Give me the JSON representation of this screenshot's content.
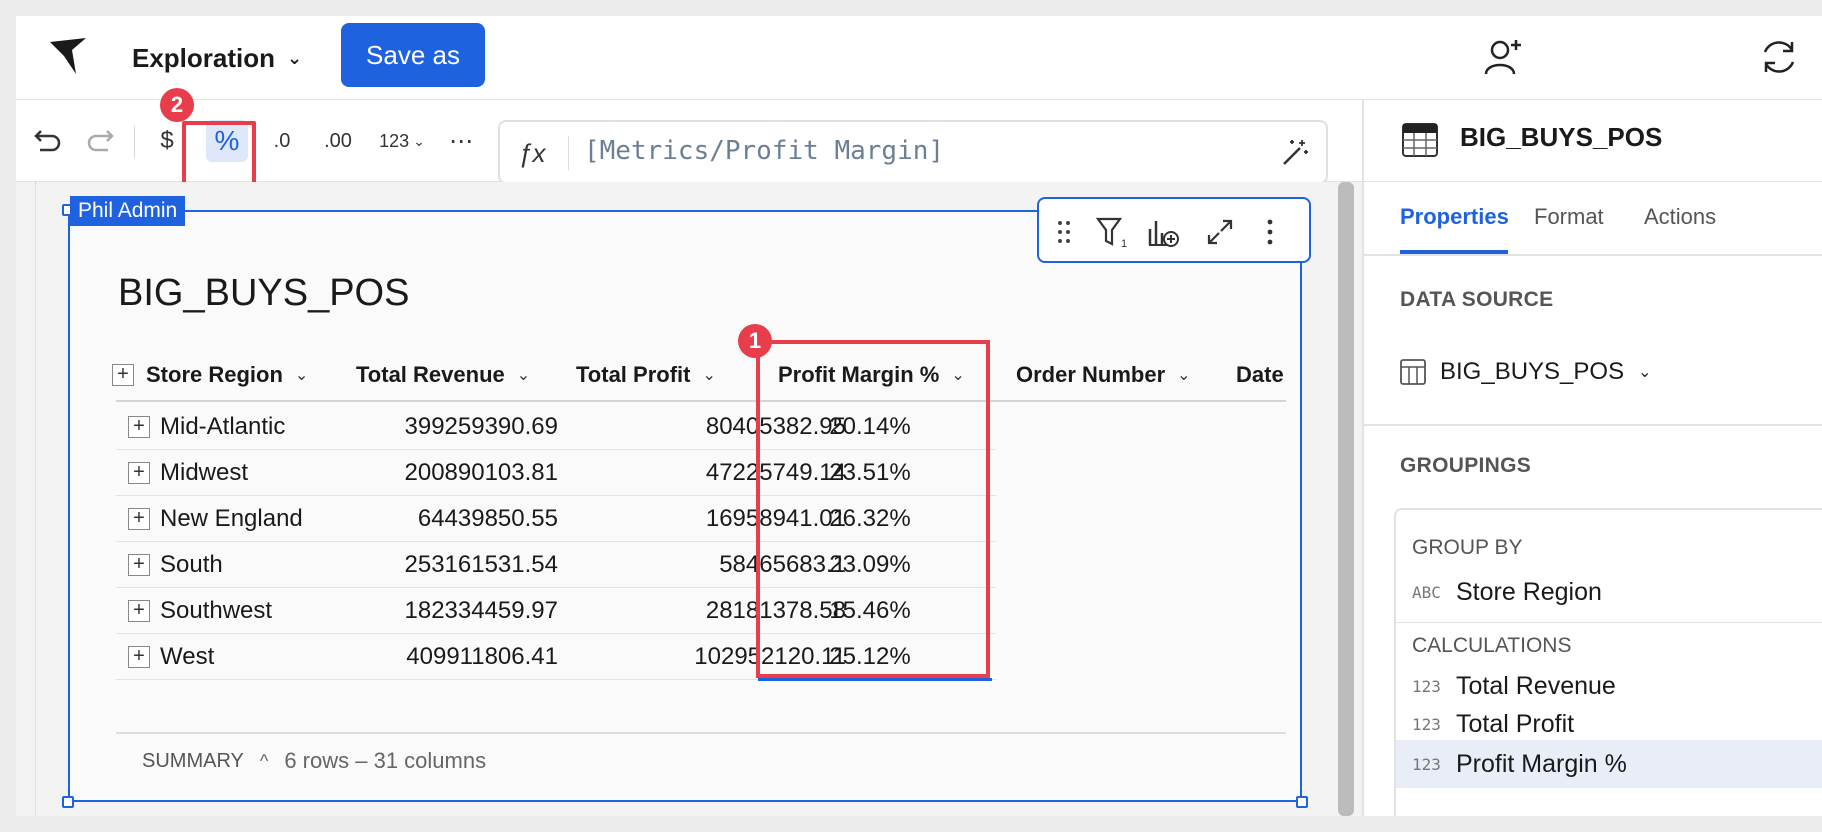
{
  "app": {
    "doc_title": "Exploration",
    "save_as_label": "Save as"
  },
  "toolbar": {
    "currency_symbol": "$",
    "percent_symbol": "%",
    "decrease_decimals": ".0",
    "increase_decimals": ".00",
    "number_format": "123",
    "more": "⋯",
    "formula": "[Metrics/Profit Margin]"
  },
  "annotations": {
    "badge1": "1",
    "badge2": "2"
  },
  "element": {
    "user_tag": "Phil Admin",
    "title": "BIG_BUYS_POS",
    "columns": [
      "Store Region",
      "Total Revenue",
      "Total Profit",
      "Profit Margin %",
      "Order Number",
      "Date"
    ],
    "rows": [
      {
        "region": "Mid-Atlantic",
        "revenue": "399259390.69",
        "profit": "80405382.95",
        "margin": "20.14%"
      },
      {
        "region": "Midwest",
        "revenue": "200890103.81",
        "profit": "47225749.14",
        "margin": "23.51%"
      },
      {
        "region": "New England",
        "revenue": "64439850.55",
        "profit": "16958941.01",
        "margin": "26.32%"
      },
      {
        "region": "South",
        "revenue": "253161531.54",
        "profit": "58465683.1",
        "margin": "23.09%"
      },
      {
        "region": "Southwest",
        "revenue": "182334459.97",
        "profit": "28181378.58",
        "margin": "15.46%"
      },
      {
        "region": "West",
        "revenue": "409911806.41",
        "profit": "102952120.11",
        "margin": "25.12%"
      }
    ],
    "summary_label": "SUMMARY",
    "summary_text": "6 rows – 31 columns"
  },
  "panel": {
    "title": "BIG_BUYS_POS",
    "tabs": [
      "Properties",
      "Format",
      "Actions"
    ],
    "data_source_label": "DATA SOURCE",
    "data_source_value": "BIG_BUYS_POS",
    "groupings_label": "GROUPINGS",
    "group_by_label": "GROUP BY",
    "group_by_items": [
      {
        "type": "ABC",
        "name": "Store Region"
      }
    ],
    "calculations_label": "CALCULATIONS",
    "calculation_items": [
      {
        "type": "123",
        "name": "Total Revenue"
      },
      {
        "type": "123",
        "name": "Total Profit"
      },
      {
        "type": "123",
        "name": "Profit Margin %"
      }
    ]
  },
  "colors": {
    "accent": "#1f62e0",
    "highlight": "#e83e4b"
  }
}
